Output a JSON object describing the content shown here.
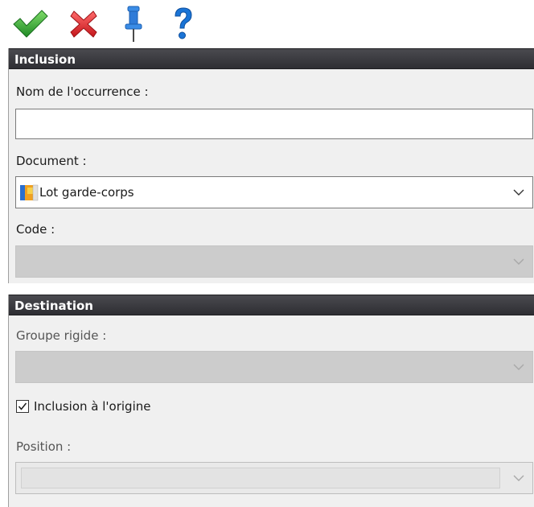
{
  "toolbar": {
    "ok_icon": "checkmark-icon",
    "cancel_icon": "close-icon",
    "pin_icon": "pushpin-icon",
    "help_icon": "help-icon",
    "colors": {
      "ok": "#3aa335",
      "cancel": "#e0262a",
      "pin": "#2f7bd8",
      "help": "#1a74d6"
    }
  },
  "inclusion": {
    "header": "Inclusion",
    "occurrence_label": "Nom de l'occurrence :",
    "occurrence_value": "",
    "document_label": "Document :",
    "document_value": "Lot garde-corps",
    "code_label": "Code :",
    "code_value": ""
  },
  "destination": {
    "header": "Destination",
    "group_label": "Groupe rigide :",
    "group_value": "",
    "origin_checkbox_label": "Inclusion à l'origine",
    "origin_checked": true,
    "position_label": "Position :",
    "position_value": ""
  },
  "colors": {
    "header_bg": "#3a3a3f",
    "panel_bg": "#f0f0f0",
    "disabled_field": "#cccccc"
  }
}
